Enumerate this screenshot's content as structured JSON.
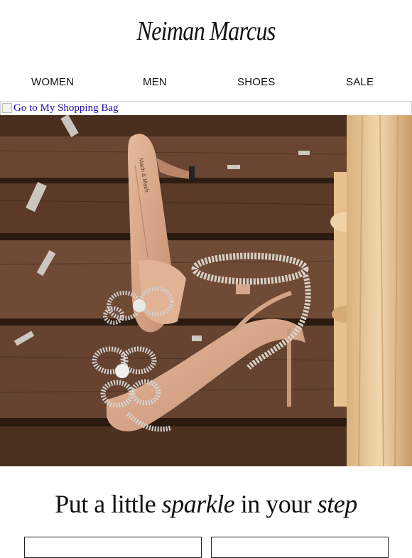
{
  "brand": {
    "name": "Neiman Marcus"
  },
  "nav": {
    "items": [
      "WOMEN",
      "MEN",
      "SHOES",
      "SALE"
    ]
  },
  "bag_link": {
    "alt_text": "Go to My Shopping Bag"
  },
  "hero": {
    "image_label": "Mach & Mach",
    "colors": {
      "wood": "#5a3a26",
      "shoe": "#d9a98d",
      "curtain": "#e8c99a"
    }
  },
  "headline": {
    "part1": "Put a little ",
    "emph1": "sparkle",
    "part2": " in your ",
    "emph2": "step"
  }
}
